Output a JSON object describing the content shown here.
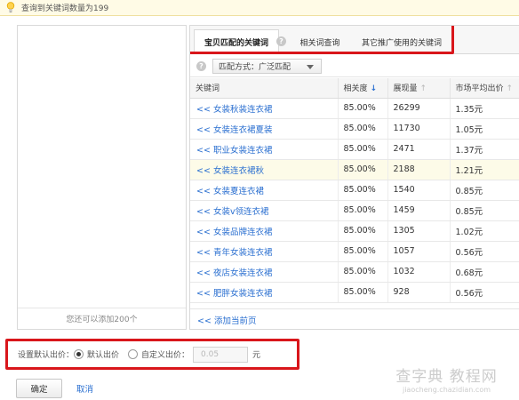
{
  "notice": {
    "text": "查询到关键词数量为199"
  },
  "left_panel": {
    "quota_text": "您还可以添加200个"
  },
  "tabs": [
    {
      "label": "宝贝匹配的关键词"
    },
    {
      "label": "相关词查询"
    },
    {
      "label": "其它推广使用的关键词"
    }
  ],
  "match": {
    "label": "匹配方式：广泛匹配"
  },
  "table": {
    "headers": {
      "keyword": "关键词",
      "relevance": "相关度",
      "impressions": "展现量",
      "market_price": "市场平均出价"
    },
    "rows": [
      {
        "keyword": "<< 女装秋装连衣裙",
        "relevance": "85.00%",
        "impressions": "26299",
        "price": "1.35元"
      },
      {
        "keyword": "<< 女装连衣裙夏装",
        "relevance": "85.00%",
        "impressions": "11730",
        "price": "1.05元"
      },
      {
        "keyword": "<< 职业女装连衣裙",
        "relevance": "85.00%",
        "impressions": "2471",
        "price": "1.37元"
      },
      {
        "keyword": "<< 女装连衣裙秋",
        "relevance": "85.00%",
        "impressions": "2188",
        "price": "1.21元"
      },
      {
        "keyword": "<< 女装夏连衣裙",
        "relevance": "85.00%",
        "impressions": "1540",
        "price": "0.85元"
      },
      {
        "keyword": "<< 女装v领连衣裙",
        "relevance": "85.00%",
        "impressions": "1459",
        "price": "0.85元"
      },
      {
        "keyword": "<< 女装品牌连衣裙",
        "relevance": "85.00%",
        "impressions": "1305",
        "price": "1.02元"
      },
      {
        "keyword": "<< 青年女装连衣裙",
        "relevance": "85.00%",
        "impressions": "1057",
        "price": "0.56元"
      },
      {
        "keyword": "<< 夜店女装连衣裙",
        "relevance": "85.00%",
        "impressions": "1032",
        "price": "0.68元"
      },
      {
        "keyword": "<< 肥胖女装连衣裙",
        "relevance": "85.00%",
        "impressions": "928",
        "price": "0.56元"
      }
    ],
    "add_page": "<< 添加当前页"
  },
  "bid": {
    "label": "设置默认出价：",
    "default_option": "默认出价",
    "custom_option": "自定义出价：",
    "input_placeholder": "0.05",
    "unit": "元"
  },
  "actions": {
    "confirm": "确定",
    "cancel": "取消"
  },
  "watermark": {
    "line1": "查字典 教程网",
    "line2": "jiaocheng.chazidian.com"
  },
  "colors": {
    "link": "#2a6fd0",
    "highlight_border": "#d9161b",
    "notice_bg": "#fffbe6",
    "row_highlight": "#fdfbe8"
  }
}
